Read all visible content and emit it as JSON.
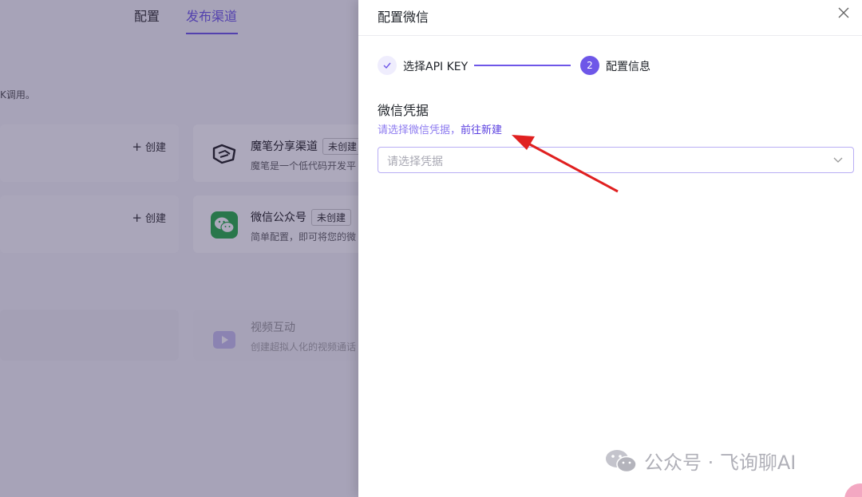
{
  "background": {
    "tabs": [
      "配置",
      "发布渠道"
    ],
    "active_tab": "发布渠道",
    "description_fragment": "K调用。",
    "left_cards": [
      {
        "create_label": "创建"
      },
      {
        "create_label": "创建"
      }
    ],
    "channels": [
      {
        "name": "魔笔分享渠道",
        "badge": "未创建",
        "desc": "魔笔是一个低代码开发平",
        "icon": "mobi-icon"
      },
      {
        "name": "微信公众号",
        "badge": "未创建",
        "desc": "简单配置，即可将您的微",
        "icon": "wechat-icon"
      },
      {
        "name": "视频互动",
        "badge": "",
        "desc": "创建超拟人化的视频通话",
        "icon": "video-icon"
      }
    ]
  },
  "drawer": {
    "title": "配置微信",
    "steps": [
      {
        "label": "选择API KEY",
        "state": "done"
      },
      {
        "index": "2",
        "label": "配置信息",
        "state": "active"
      }
    ],
    "section_title": "微信凭据",
    "hint_text": "请选择微信凭据，",
    "hint_link": "前往新建",
    "select_placeholder": "请选择凭据"
  },
  "watermark": {
    "text": "公众号 · 飞询聊AI"
  },
  "colors": {
    "accent": "#6e57e8",
    "annotation_arrow": "#e02020",
    "wechat_green": "#2aae4a"
  }
}
